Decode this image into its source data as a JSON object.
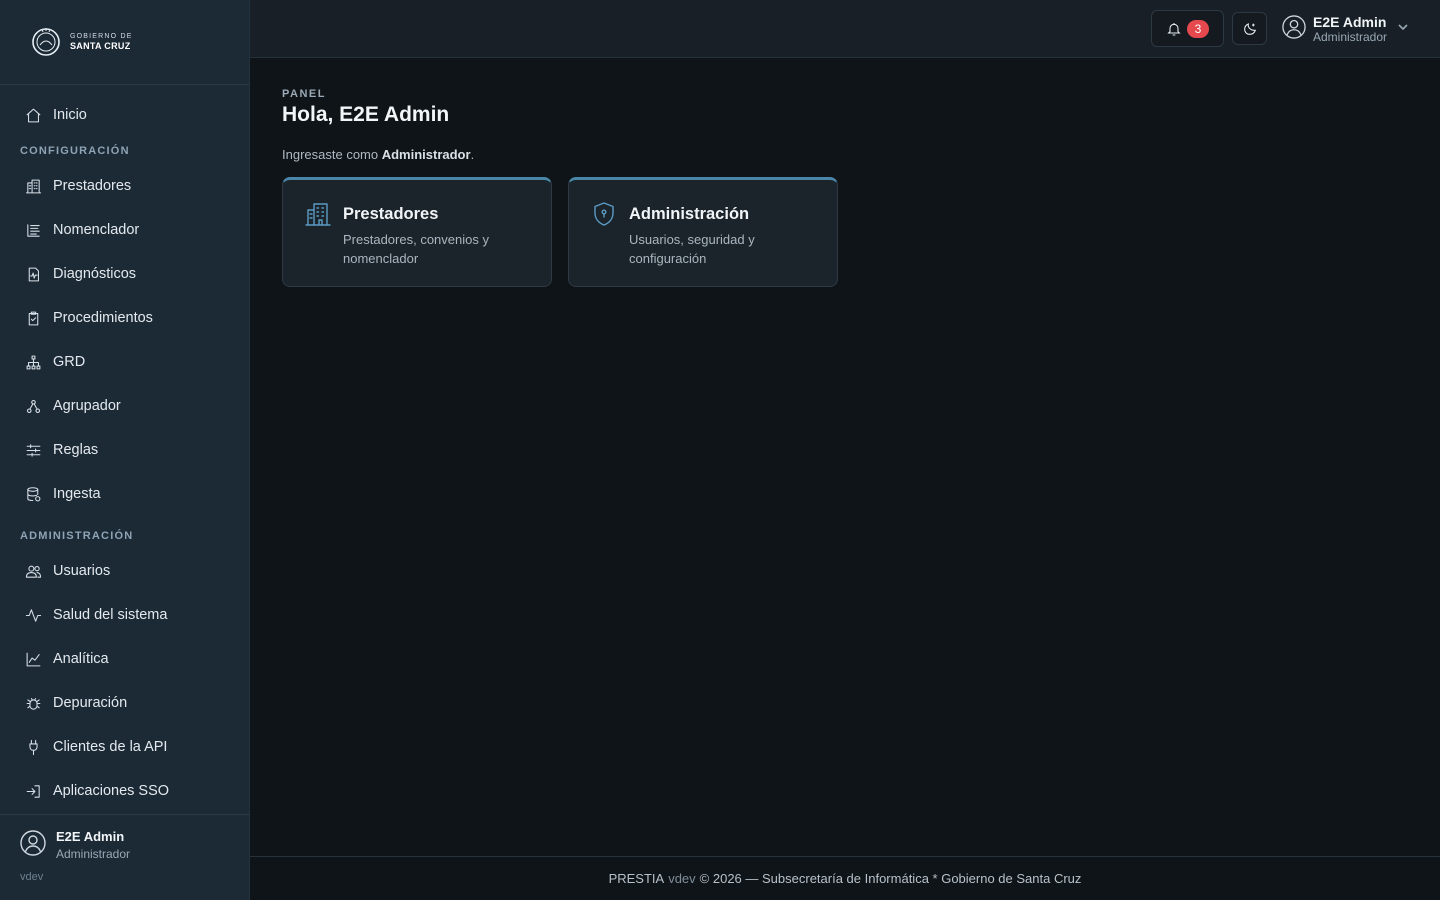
{
  "brand": {
    "top_text": "GOBIERNO DE",
    "bottom_text": "SANTA CRUZ"
  },
  "sidebar": {
    "home": {
      "label": "Inicio",
      "icon": "home-icon"
    },
    "sections": [
      {
        "title": "CONFIGURACIÓN",
        "items": [
          {
            "label": "Prestadores",
            "icon": "building-icon"
          },
          {
            "label": "Nomenclador",
            "icon": "list-icon"
          },
          {
            "label": "Diagnósticos",
            "icon": "file-pulse-icon"
          },
          {
            "label": "Procedimientos",
            "icon": "clipboard-check-icon"
          },
          {
            "label": "GRD",
            "icon": "hierarchy-icon"
          },
          {
            "label": "Agrupador",
            "icon": "cluster-icon"
          },
          {
            "label": "Reglas",
            "icon": "sliders-icon"
          },
          {
            "label": "Ingesta",
            "icon": "database-icon"
          }
        ]
      },
      {
        "title": "ADMINISTRACIÓN",
        "items": [
          {
            "label": "Usuarios",
            "icon": "users-icon"
          },
          {
            "label": "Salud del sistema",
            "icon": "activity-icon"
          },
          {
            "label": "Analítica",
            "icon": "chart-line-icon"
          },
          {
            "label": "Depuración",
            "icon": "bug-icon"
          },
          {
            "label": "Clientes de la API",
            "icon": "plug-icon"
          },
          {
            "label": "Aplicaciones SSO",
            "icon": "login-icon"
          }
        ]
      }
    ],
    "user": {
      "name": "E2E Admin",
      "role": "Administrador",
      "version": "vdev"
    }
  },
  "topbar": {
    "notifications_count": "3",
    "user": {
      "name": "E2E Admin",
      "role": "Administrador"
    }
  },
  "main": {
    "eyebrow": "PANEL",
    "title": "Hola, E2E Admin",
    "subtitle_prefix": "Ingresaste como ",
    "subtitle_role": "Administrador",
    "subtitle_suffix": ".",
    "cards": [
      {
        "title": "Prestadores",
        "description": "Prestadores, convenios y nomenclador",
        "icon": "building-icon"
      },
      {
        "title": "Administración",
        "description": "Usuarios, seguridad y configuración",
        "icon": "shield-icon"
      }
    ]
  },
  "footer": {
    "product": "PRESTIA",
    "version": "vdev",
    "text": "© 2026 — Subsecretaría de Informática * Gobierno de Santa Cruz"
  },
  "colors": {
    "accent": "#4a86a8",
    "badge": "#e5484d",
    "sidebar_bg": "#1c2a36",
    "main_bg": "#0f1418"
  }
}
